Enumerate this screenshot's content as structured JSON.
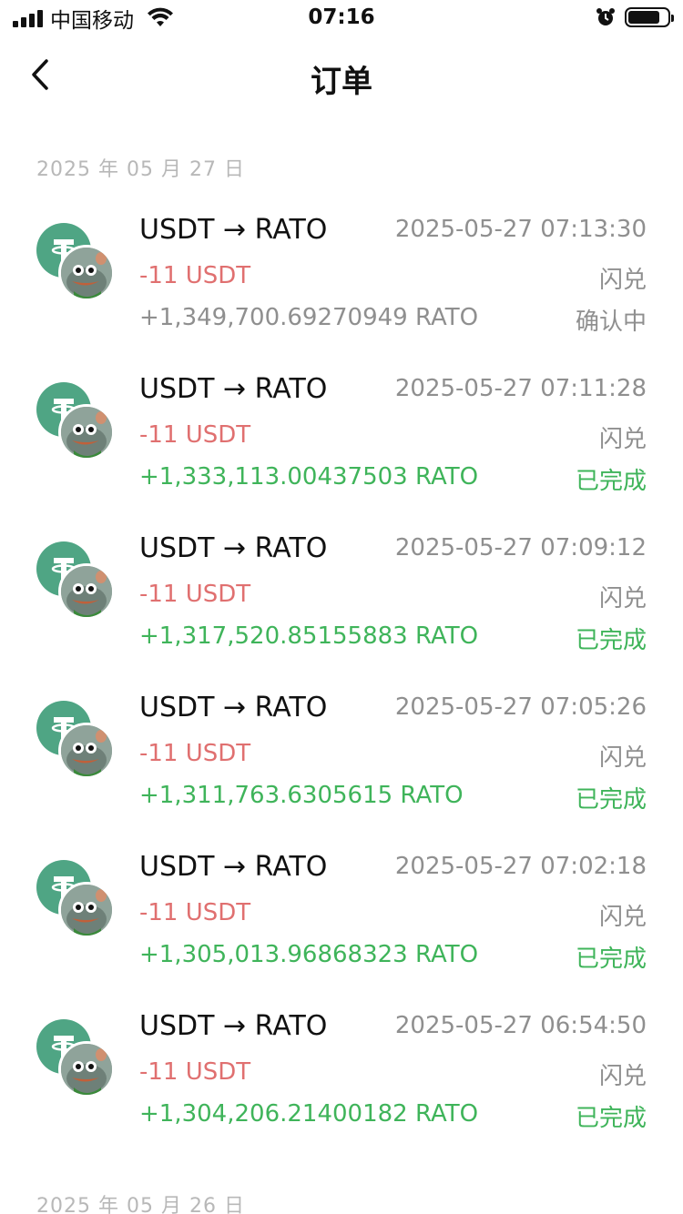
{
  "status_bar": {
    "carrier": "中国移动",
    "time": "07:16"
  },
  "nav": {
    "title": "订单"
  },
  "groups": [
    {
      "date": "2025 年 05 月 27 日"
    },
    {
      "date": "2025 年 05 月 26 日"
    }
  ],
  "orders": [
    {
      "pair": "USDT → RATO",
      "time": "2025-05-27 07:13:30",
      "sent": "-11 USDT",
      "kind": "闪兑",
      "received": "+1,349,700.69270949 RATO",
      "status": "确认中"
    },
    {
      "pair": "USDT → RATO",
      "time": "2025-05-27 07:11:28",
      "sent": "-11 USDT",
      "kind": "闪兑",
      "received": "+1,333,113.00437503 RATO",
      "status": "已完成"
    },
    {
      "pair": "USDT → RATO",
      "time": "2025-05-27 07:09:12",
      "sent": "-11 USDT",
      "kind": "闪兑",
      "received": "+1,317,520.85155883 RATO",
      "status": "已完成"
    },
    {
      "pair": "USDT → RATO",
      "time": "2025-05-27 07:05:26",
      "sent": "-11 USDT",
      "kind": "闪兑",
      "received": "+1,311,763.6305615 RATO",
      "status": "已完成"
    },
    {
      "pair": "USDT → RATO",
      "time": "2025-05-27 07:02:18",
      "sent": "-11 USDT",
      "kind": "闪兑",
      "received": "+1,305,013.96868323 RATO",
      "status": "已完成"
    },
    {
      "pair": "USDT → RATO",
      "time": "2025-05-27 06:54:50",
      "sent": "-11 USDT",
      "kind": "闪兑",
      "received": "+1,304,206.21400182 RATO",
      "status": "已完成"
    }
  ],
  "colors": {
    "negative": "#e07070",
    "positive": "#3fb45a",
    "muted": "#8f8f8f",
    "usdt": "#4fa584"
  },
  "icons": {
    "usdt": "tether-coin-icon",
    "rato": "rato-frog-avatar-icon"
  }
}
